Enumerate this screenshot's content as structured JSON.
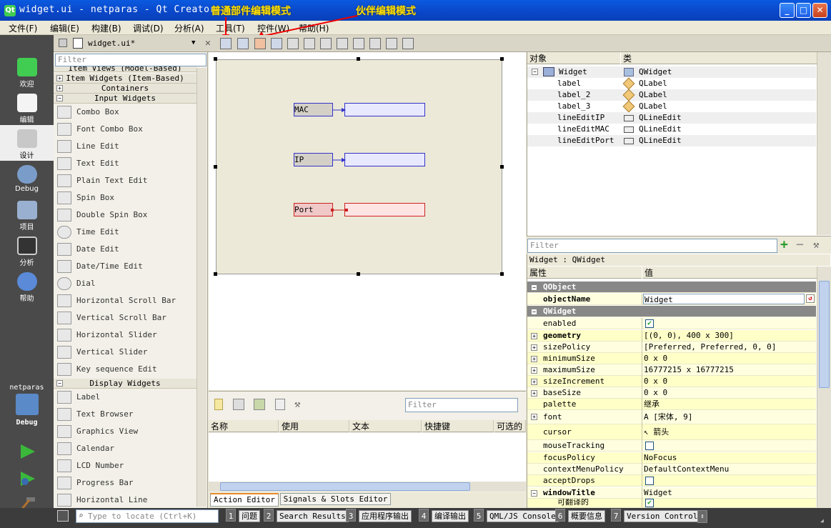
{
  "window": {
    "title": "widget.ui - netparas - Qt Creator",
    "icon_text": "Qt",
    "min": "_",
    "max": "□",
    "close": "✕"
  },
  "menu": [
    "文件(F)",
    "编辑(E)",
    "构建(B)",
    "调试(D)",
    "分析(A)",
    "工具(T)",
    "控件(W)",
    "帮助(H)"
  ],
  "annotations": {
    "normal_mode": "普通部件编辑模式",
    "buddy_mode": "伙伴编辑模式"
  },
  "modes": [
    {
      "label": "欢迎"
    },
    {
      "label": "编辑"
    },
    {
      "label": "设计"
    },
    {
      "label": "Debug"
    },
    {
      "label": "项目"
    },
    {
      "label": "分析"
    },
    {
      "label": "帮助"
    }
  ],
  "kit": {
    "project": "netparas",
    "label": "Debug"
  },
  "editor_tab": {
    "file": "widget.ui*",
    "close": "✕"
  },
  "widget_box": {
    "filter_placeholder": "Filter",
    "categories": {
      "item_views": "Item Views (Model-Based)",
      "item_widgets": "Item Widgets (Item-Based)",
      "containers": "Containers",
      "input_widgets": "Input Widgets",
      "display_widgets": "Display Widgets"
    },
    "input_items": [
      "Combo Box",
      "Font Combo Box",
      "Line Edit",
      "Text Edit",
      "Plain Text Edit",
      "Spin Box",
      "Double Spin Box",
      "Time Edit",
      "Date Edit",
      "Date/Time Edit",
      "Dial",
      "Horizontal Scroll Bar",
      "Vertical Scroll Bar",
      "Horizontal Slider",
      "Vertical Slider",
      "Key sequence Edit"
    ],
    "display_items": [
      "Label",
      "Text Browser",
      "Graphics View",
      "Calendar",
      "LCD Number",
      "Progress Bar",
      "Horizontal Line"
    ]
  },
  "form": {
    "labels": [
      "MAC",
      "IP",
      "Port"
    ]
  },
  "action_editor": {
    "filter_placeholder": "Filter",
    "columns": [
      "名称",
      "使用",
      "文本",
      "快捷键",
      "可选的"
    ],
    "tabs": [
      "Action Editor",
      "Signals & Slots Editor"
    ]
  },
  "object_inspector": {
    "columns": [
      "对象",
      "类"
    ],
    "rows": [
      {
        "name": "Widget",
        "class": "QWidget"
      },
      {
        "name": "label",
        "class": "QLabel"
      },
      {
        "name": "label_2",
        "class": "QLabel"
      },
      {
        "name": "label_3",
        "class": "QLabel"
      },
      {
        "name": "lineEditIP",
        "class": "QLineEdit"
      },
      {
        "name": "lineEditMAC",
        "class": "QLineEdit"
      },
      {
        "name": "lineEditPort",
        "class": "QLineEdit"
      }
    ]
  },
  "property_editor": {
    "filter_placeholder": "Filter",
    "context": "Widget : QWidget",
    "columns": [
      "属性",
      "值"
    ],
    "rows": [
      {
        "name": "QObject",
        "value": "",
        "type": "group"
      },
      {
        "name": "objectName",
        "value": "Widget",
        "bold": true
      },
      {
        "name": "QWidget",
        "value": "",
        "type": "group"
      },
      {
        "name": "enabled",
        "value": "",
        "check": "✔"
      },
      {
        "name": "geometry",
        "value": "[(0, 0), 400 x 300]",
        "bold": true,
        "expand": "+"
      },
      {
        "name": "sizePolicy",
        "value": "[Preferred, Preferred, 0, 0]",
        "expand": "+"
      },
      {
        "name": "minimumSize",
        "value": "0 x 0",
        "expand": "+"
      },
      {
        "name": "maximumSize",
        "value": "16777215 x 16777215",
        "expand": "+"
      },
      {
        "name": "sizeIncrement",
        "value": "0 x 0",
        "expand": "+"
      },
      {
        "name": "baseSize",
        "value": "0 x 0",
        "expand": "+"
      },
      {
        "name": "palette",
        "value": "继承"
      },
      {
        "name": "font",
        "value": "A  [宋体, 9]",
        "expand": "+"
      },
      {
        "name": "cursor",
        "value": "↖  箭头"
      },
      {
        "name": "mouseTracking",
        "value": "",
        "check": ""
      },
      {
        "name": "focusPolicy",
        "value": "NoFocus"
      },
      {
        "name": "contextMenuPolicy",
        "value": "DefaultContextMenu"
      },
      {
        "name": "acceptDrops",
        "value": "",
        "check": ""
      },
      {
        "name": "windowTitle",
        "value": "Widget",
        "bold": true,
        "expand": "−"
      },
      {
        "name": "可翻译的",
        "value": "",
        "check": "✔"
      }
    ]
  },
  "status": {
    "locate_placeholder": "Type to locate (Ctrl+K)",
    "tabs": [
      {
        "num": "1",
        "label": "问题"
      },
      {
        "num": "2",
        "label": "Search Results"
      },
      {
        "num": "3",
        "label": "应用程序输出"
      },
      {
        "num": "4",
        "label": "编译输出"
      },
      {
        "num": "5",
        "label": "QML/JS Console"
      },
      {
        "num": "6",
        "label": "概要信息"
      },
      {
        "num": "7",
        "label": "Version Control"
      }
    ]
  },
  "colors": {
    "title_bar": "#0a50d8",
    "modebar": "#4a4a4a",
    "buddy_border": "#3333cc",
    "selected_buddy": "#cc2222",
    "annotation": "#ffe000"
  }
}
